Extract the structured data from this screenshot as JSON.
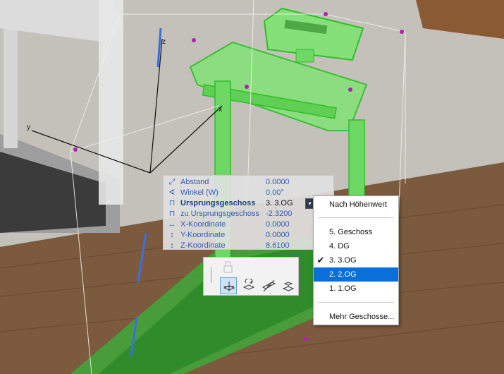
{
  "tracker": {
    "rows": [
      {
        "icon": "distance-icon",
        "glyph": "⤢",
        "label": "Abstand",
        "value": "0.0000"
      },
      {
        "icon": "angle-icon",
        "glyph": "∢",
        "label": "Winkel (W)",
        "value": "0.00°"
      },
      {
        "icon": "origin-story-icon",
        "glyph": "⊓",
        "label": "Ursprungsgeschoss",
        "value": "3. 3.OG"
      },
      {
        "icon": "offset-to-story-icon",
        "glyph": "⊓",
        "label": "zu Ursprungsgeschoss",
        "value": "-2.3200"
      },
      {
        "icon": "x-coordinate-icon",
        "glyph": "↔",
        "label": "X-Koordinate",
        "value": "0.0000"
      },
      {
        "icon": "y-coordinate-icon",
        "glyph": "↕",
        "label": "Y-Koordinate",
        "value": "0.0000"
      },
      {
        "icon": "z-coordinate-icon",
        "glyph": "↕",
        "label": "Z-Koordinate",
        "value": "8.6100"
      }
    ]
  },
  "story_menu": {
    "by_elevation": "Nach Höhenwert",
    "items": [
      "5. Geschoss",
      "4. DG",
      "3. 3.OG",
      "2. 2.OG",
      "1. 1.OG"
    ],
    "checked": "3. 3.OG",
    "highlighted": "2. 2.OG",
    "more": "Mehr Geschosse..."
  },
  "axes": {
    "x": "x",
    "y": "y",
    "z": "z"
  },
  "colors": {
    "selection": "#33cc33",
    "tracker_text": "#2f5fb8",
    "menu_highlight": "#0a6fd6"
  }
}
